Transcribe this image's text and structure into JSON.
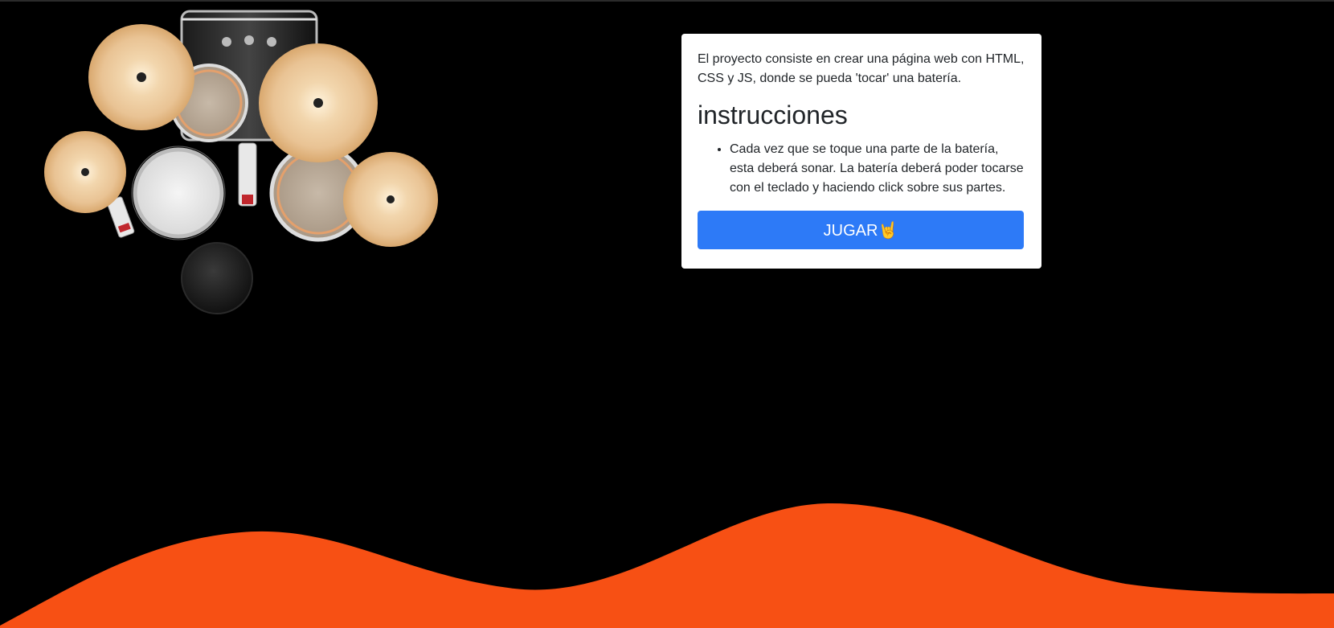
{
  "info": {
    "description": "El proyecto consiste en crear una página web con HTML, CSS y JS, donde se pueda 'tocar' una batería.",
    "heading": "instrucciones",
    "items": [
      "Cada vez que se toque una parte de la batería, esta deberá sonar. La batería deberá poder tocarse con el teclado y haciendo click sobre sus partes."
    ],
    "play_label": "JUGAR🤘"
  },
  "colors": {
    "background": "#000000",
    "wave": "#f75014",
    "button": "#2d7af7",
    "card": "#ffffff"
  }
}
